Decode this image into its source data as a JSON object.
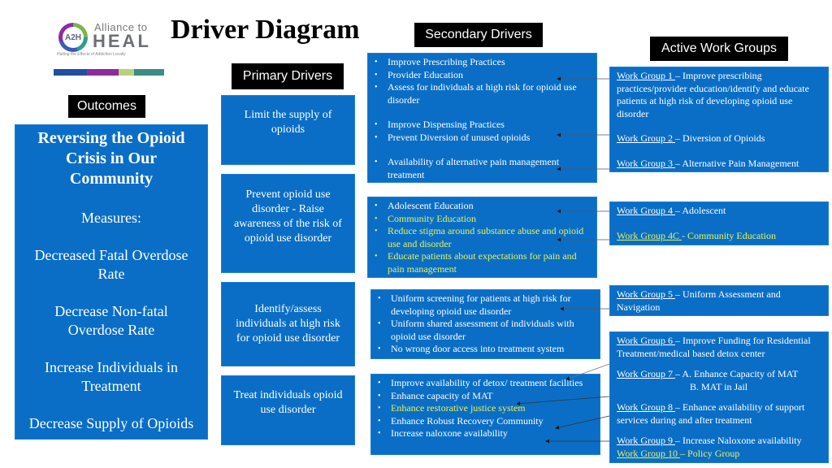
{
  "logo": {
    "badge": "A2H",
    "line1": "Alliance to",
    "line2": "HEAL",
    "tagline": "Halting the Effects of Addiction Locally",
    "bar_colors": [
      "#1f4ea3",
      "#8e2a9e",
      "#b7d27d",
      "#3a8c86"
    ]
  },
  "title": "Driver Diagram",
  "headers": {
    "outcomes": "Outcomes",
    "primary": "Primary Drivers",
    "secondary": "Secondary Drivers",
    "work_groups": "Active Work Groups"
  },
  "colors": {
    "box_blue": "#0a6ec6",
    "highlight_yellow": "#e6f25a",
    "header_black": "#000000"
  },
  "outcome": {
    "title": "Reversing the Opioid Crisis in Our Community",
    "measures_label": "Measures:",
    "measures": [
      "Decreased Fatal Overdose Rate",
      "Decrease Non-fatal Overdose Rate",
      "Increase Individuals in Treatment",
      "Decrease Supply of Opioids"
    ]
  },
  "primary_drivers": [
    "Limit the supply of opioids",
    "Prevent opioid use disorder - Raise awareness of the risk of opioid use disorder",
    "Identify/assess individuals at high risk for opioid use disorder",
    "Treat individuals opioid use disorder"
  ],
  "secondary_drivers": [
    {
      "items": [
        {
          "text": "Improve Prescribing Practices",
          "highlight": false
        },
        {
          "text": "Provider Education",
          "highlight": false
        },
        {
          "text": "Assess for individuals at high risk for opioid use disorder",
          "highlight": false
        },
        {
          "text": "Improve Dispensing Practices",
          "highlight": false
        },
        {
          "text": "Prevent Diversion of unused opioids",
          "highlight": false
        },
        {
          "text": "Availability of alternative pain management treatment",
          "highlight": false
        }
      ]
    },
    {
      "items": [
        {
          "text": "Adolescent Education",
          "highlight": false
        },
        {
          "text": "Community Education",
          "highlight": true
        },
        {
          "text": "Reduce stigma around substance abuse and opioid use and disorder",
          "highlight": true
        },
        {
          "text": "Educate patients about expectations for pain and pain management",
          "highlight": true
        }
      ]
    },
    {
      "items": [
        {
          "text": "Uniform screening for patients at high risk for developing opioid use disorder",
          "highlight": false
        },
        {
          "text": "Uniform shared assessment of individuals with opioid use disorder",
          "highlight": false
        },
        {
          "text": "No wrong door access into treatment system",
          "highlight": false
        }
      ]
    },
    {
      "items": [
        {
          "text": "Improve availability of detox/ treatment facilities",
          "highlight": false
        },
        {
          "text": "Enhance capacity of MAT",
          "highlight": false
        },
        {
          "text": "Enhance restorative justice system",
          "highlight": true
        },
        {
          "text": "Enhance Robust Recovery Community",
          "highlight": false
        },
        {
          "text": "Increase naloxone availability",
          "highlight": false
        }
      ]
    }
  ],
  "work_groups": [
    {
      "link": "Work Group 1 ",
      "desc": "– Improve prescribing practices/provider education/identify and educate patients at high risk of developing opioid use disorder",
      "highlight": false
    },
    {
      "link": "Work Group 2 ",
      "desc": "– Diversion of Opioids",
      "highlight": false
    },
    {
      "link": "Work Group 3 ",
      "desc": "– Alternative Pain Management",
      "highlight": false
    },
    {
      "link": "Work Group 4 ",
      "desc": "– Adolescent",
      "highlight": false
    },
    {
      "link": "Work Group 4C ",
      "desc": "- Community Education",
      "highlight": true
    },
    {
      "link": "Work Group 5 ",
      "desc": "– Uniform Assessment and Navigation",
      "highlight": false
    },
    {
      "link": "Work Group 6 ",
      "desc": "– Improve Funding for Residential Treatment/medical based detox center",
      "highlight": false
    },
    {
      "link": "Work Group 7 ",
      "desc": "–  A. Enhance Capacity of MAT",
      "desc2": "B. MAT in Jail",
      "highlight": false
    },
    {
      "link": "Work Group 8 ",
      "desc": "– Enhance availability of support services during and after treatment",
      "highlight": false
    },
    {
      "link": "Work Group 9 ",
      "desc": "– Increase Naloxone availability",
      "highlight": false
    },
    {
      "link": "Work Group 10 ",
      "desc": "– Policy Group",
      "highlight": true
    }
  ]
}
